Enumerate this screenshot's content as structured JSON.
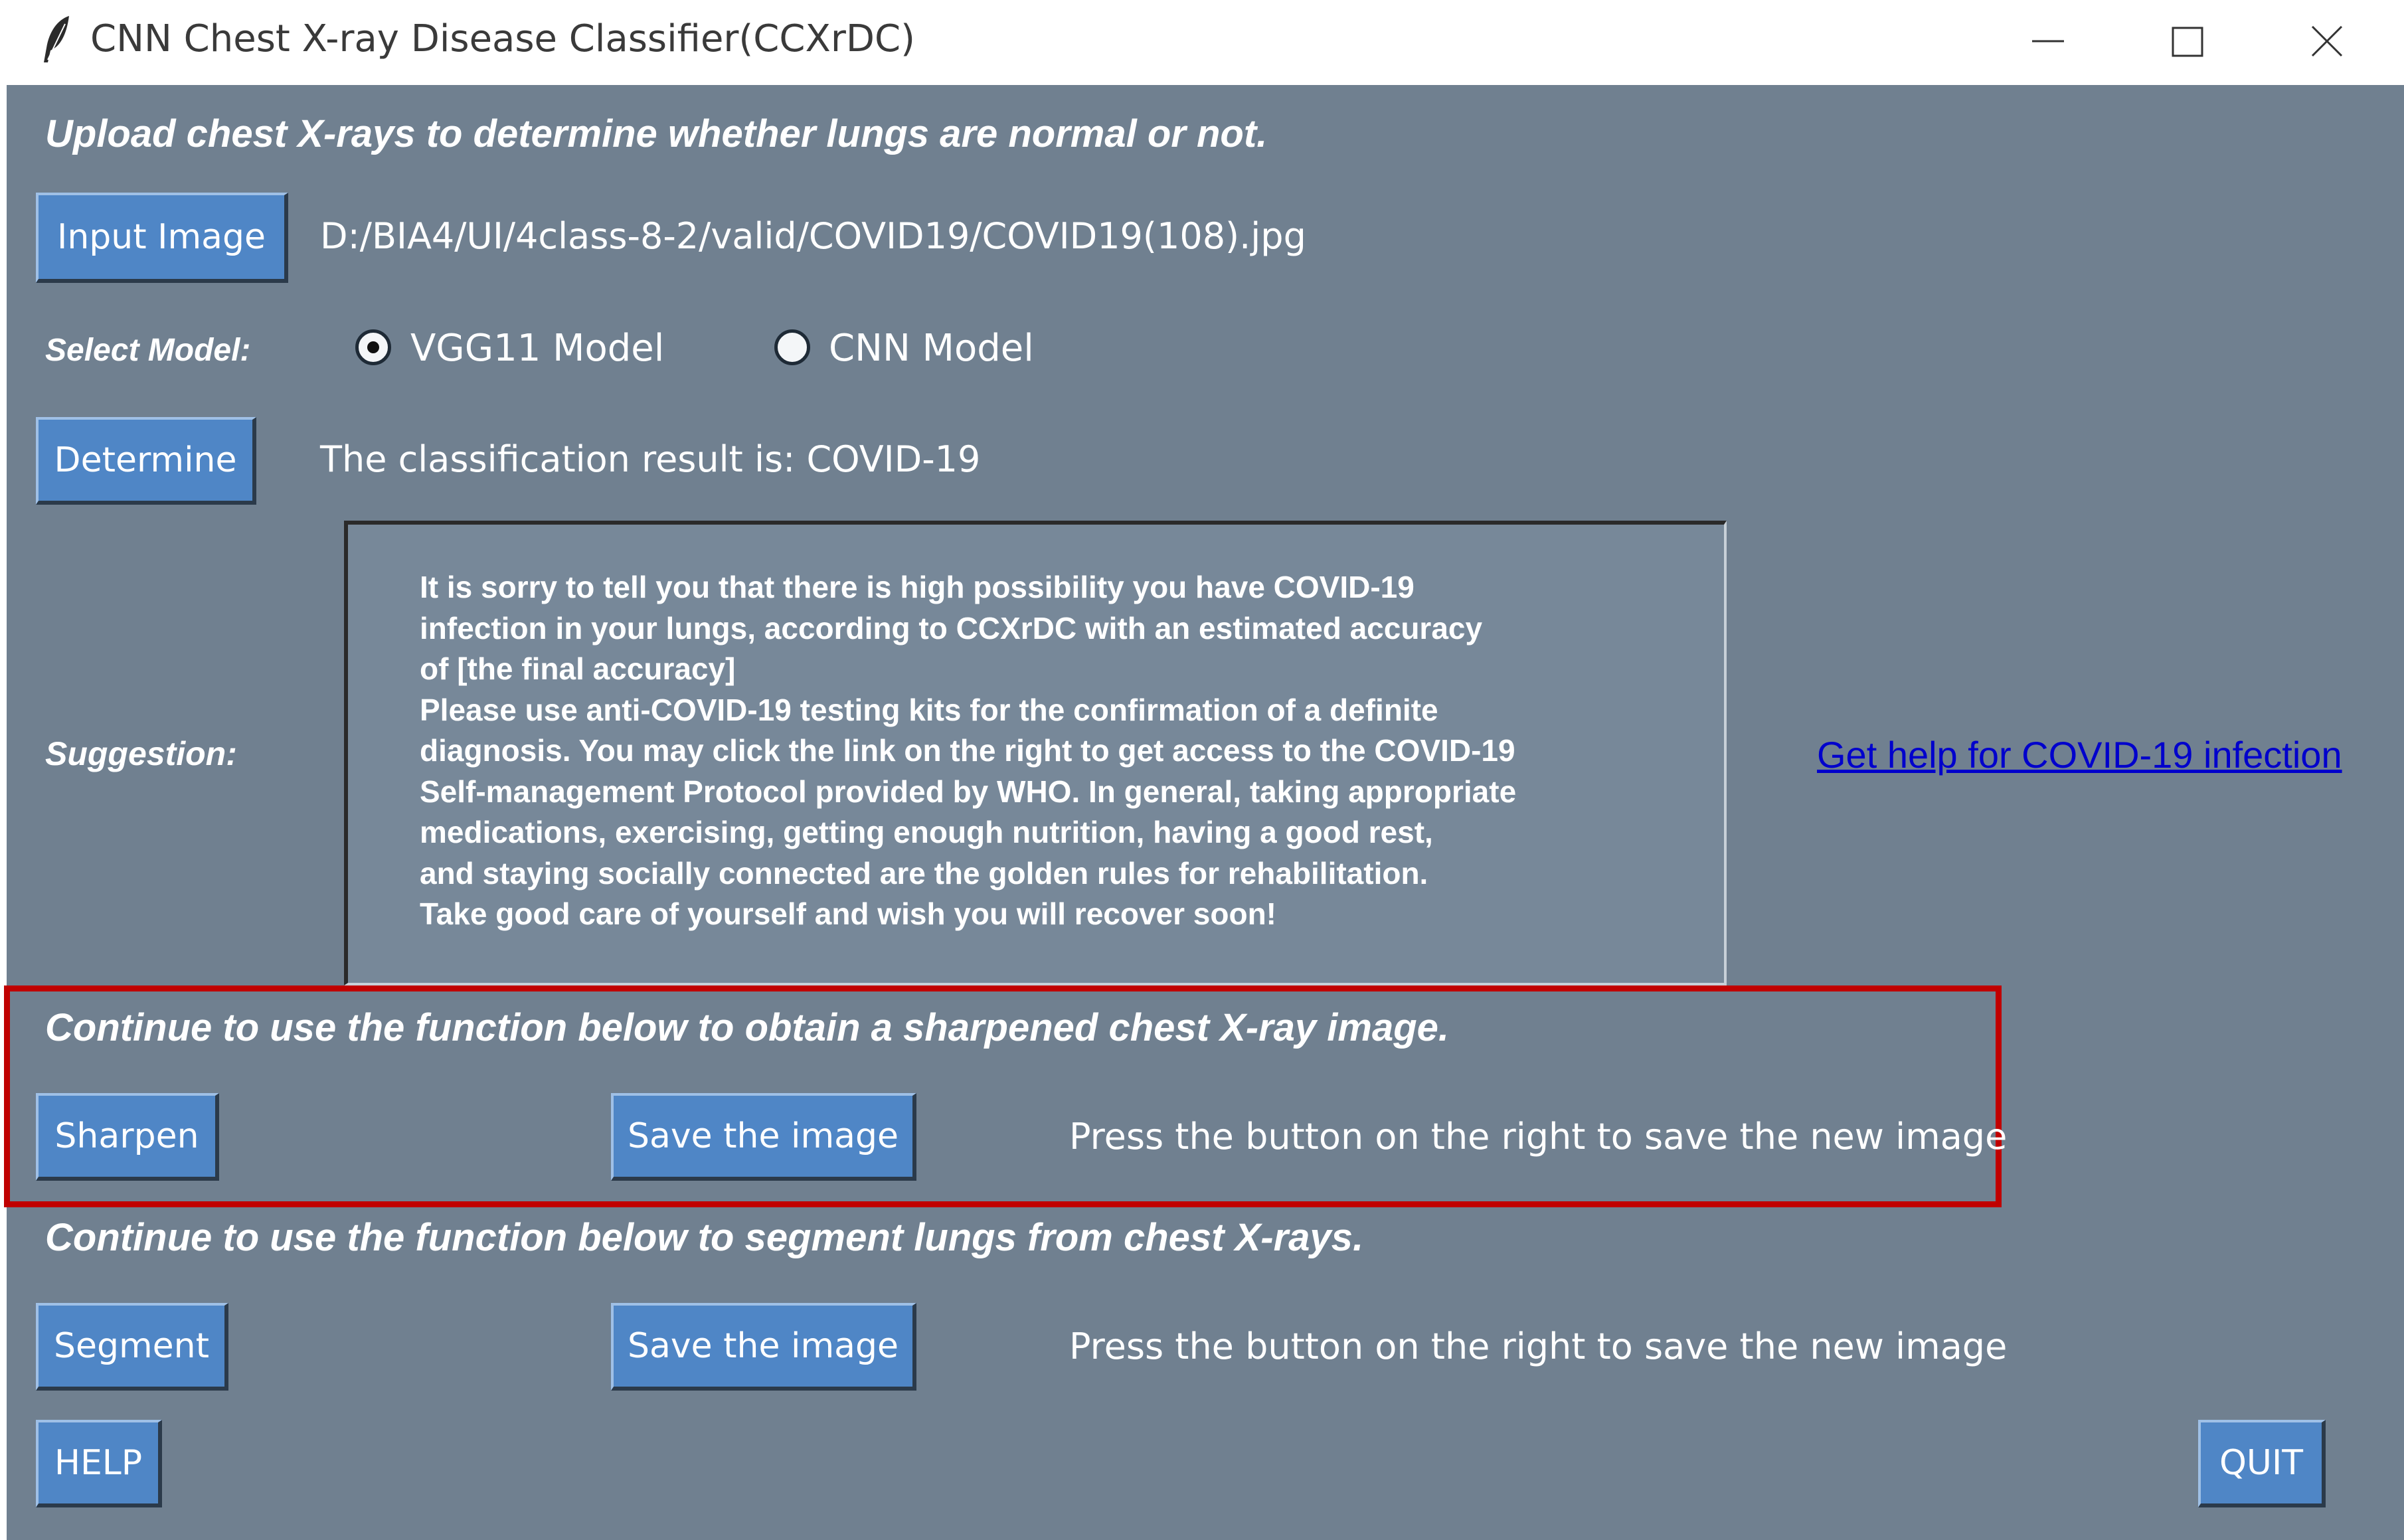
{
  "window": {
    "title": "CNN Chest X-ray Disease Classifier(CCXrDC)"
  },
  "header": {
    "instruction": "Upload chest X-rays to determine whether lungs are normal or not."
  },
  "input": {
    "button_label": "Input Image",
    "file_path": "D:/BIA4/UI/4class-8-2/valid/COVID19/COVID19(108).jpg"
  },
  "model": {
    "label": "Select Model:",
    "options": [
      {
        "label": "VGG11 Model",
        "selected": true
      },
      {
        "label": "CNN Model",
        "selected": false
      }
    ]
  },
  "determine": {
    "button_label": "Determine",
    "result_text": "The classification result is: COVID-19"
  },
  "suggestion": {
    "label": "Suggestion:",
    "text": "It is sorry to tell you that there is high possibility you have COVID-19\ninfection in your lungs, according to CCXrDC with an estimated accuracy\nof [the final accuracy]\nPlease use anti-COVID-19 testing kits for the confirmation of a definite\ndiagnosis. You may click the link on the right to get access to the COVID-19\nSelf-management Protocol provided by WHO. In general, taking appropriate\nmedications, exercising, getting enough nutrition, having a good rest,\nand staying socially connected are the golden rules for rehabilitation.\nTake good care of yourself and wish you will recover soon!",
    "help_link": "Get help for COVID-19 infection"
  },
  "sharpen": {
    "heading": "Continue to use the function below to obtain a sharpened chest X-ray image.",
    "button_label": "Sharpen",
    "save_label": "Save the image",
    "hint": "Press the button on the right to save the new image"
  },
  "segment": {
    "heading": "Continue to use the function below to segment lungs from chest X-rays.",
    "button_label": "Segment",
    "save_label": "Save the image",
    "hint": "Press the button on the right to save the new image"
  },
  "footer": {
    "help_label": "HELP",
    "quit_label": "QUIT"
  },
  "colors": {
    "background": "#708090",
    "button": "#4f86c6",
    "link": "#0000cc",
    "highlight": "#c00000"
  },
  "icons": {
    "app": "feather-icon",
    "minimize": "minimize-icon",
    "maximize": "maximize-icon",
    "close": "close-icon"
  }
}
